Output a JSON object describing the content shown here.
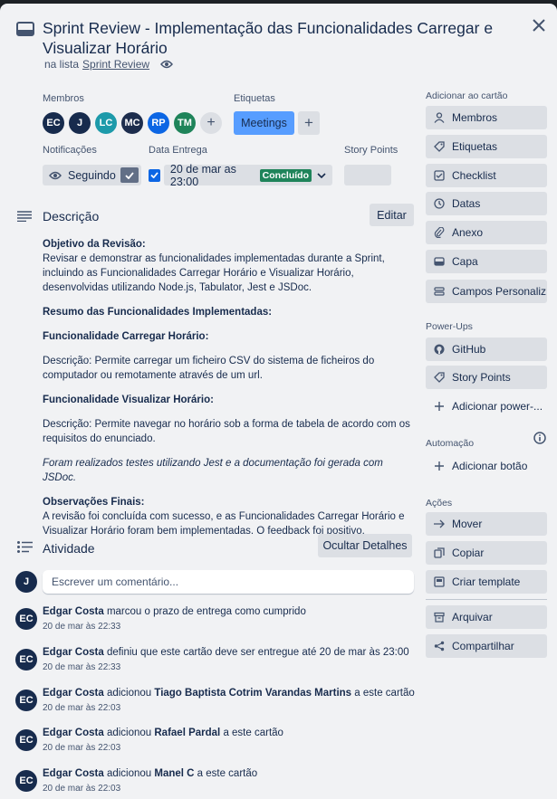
{
  "card": {
    "title": "Sprint Review - Implementação das Funcionalidades Carregar e Visualizar Horário",
    "in_list_prefix": "na lista",
    "list_name": "Sprint Review"
  },
  "members": {
    "label": "Membros",
    "avatars": [
      {
        "initials": "EC",
        "color": "#172b4d"
      },
      {
        "initials": "J",
        "color": "#172b4d"
      },
      {
        "initials": "LC",
        "color": "#1d9aaa"
      },
      {
        "initials": "MC",
        "color": "#1d2d4d"
      },
      {
        "initials": "RP",
        "color": "#0c66e4"
      },
      {
        "initials": "TM",
        "color": "#1f845a"
      }
    ],
    "add": "+"
  },
  "labels": {
    "label": "Etiquetas",
    "chip": "Meetings",
    "add": "+"
  },
  "notifications": {
    "label": "Notificações",
    "value": "Seguindo"
  },
  "due": {
    "label": "Data Entrega",
    "value": "20 de mar as 23:00",
    "badge": "Concluído"
  },
  "story_points": {
    "label": "Story Points"
  },
  "description": {
    "title": "Descrição",
    "edit": "Editar",
    "objective_title": "Objetivo da Revisão:",
    "objective_text": "Revisar e demonstrar as funcionalidades implementadas durante a Sprint, incluindo as Funcionalidades Carregar Horário e Visualizar Horário, desenvolvidas utilizando Node.js, Tabulator, Jest e JSDoc.",
    "summary_title": "Resumo das Funcionalidades Implementadas:",
    "f1_title": "Funcionalidade Carregar Horário:",
    "f1_text": "Descrição: Permite carregar um ficheiro CSV do sistema de ficheiros do computador ou remotamente através de um url.",
    "f2_title": "Funcionalidade Visualizar Horário:",
    "f2_text": "Descrição: Permite navegar no horário sob a forma de tabela de acordo com os requisitos do enunciado.",
    "tests_text": "Foram realizados testes utilizando Jest e a documentação foi gerada com JSDoc.",
    "final_title": "Observações Finais:",
    "final_text": "A revisão foi concluída com sucesso, e as Funcionalidades Carregar Horário e Visualizar Horário foram bem implementadas. O feedback foi positivo."
  },
  "activity": {
    "title": "Atividade",
    "hide_details": "Ocultar Detalhes",
    "comment_avatar": "J",
    "comment_placeholder": "Escrever um comentário...",
    "items": [
      {
        "initials": "EC",
        "who": "Edgar Costa",
        "text": " marcou o prazo de entrega como cumprido",
        "bold": "",
        "tail": "",
        "time": "20 de mar às 22:33"
      },
      {
        "initials": "EC",
        "who": "Edgar Costa",
        "text": " definiu que este cartão deve ser entregue até 20 de mar às 23:00",
        "bold": "",
        "tail": "",
        "time": "20 de mar às 22:33"
      },
      {
        "initials": "EC",
        "who": "Edgar Costa",
        "text": " adicionou ",
        "bold": "Tiago Baptista Cotrim Varandas Martins",
        "tail": " a este cartão",
        "time": "20 de mar às 22:03"
      },
      {
        "initials": "EC",
        "who": "Edgar Costa",
        "text": " adicionou ",
        "bold": "Rafael Pardal",
        "tail": " a este cartão",
        "time": "20 de mar às 22:03"
      },
      {
        "initials": "EC",
        "who": "Edgar Costa",
        "text": " adicionou ",
        "bold": "Manel C",
        "tail": " a este cartão",
        "time": "20 de mar às 22:03"
      }
    ]
  },
  "sidebar": {
    "add_label": "Adicionar ao cartão",
    "add_items": [
      {
        "label": "Membros",
        "icon": "user-icon"
      },
      {
        "label": "Etiquetas",
        "icon": "tag-icon"
      },
      {
        "label": "Checklist",
        "icon": "checklist-icon"
      },
      {
        "label": "Datas",
        "icon": "clock-icon"
      },
      {
        "label": "Anexo",
        "icon": "paperclip-icon"
      },
      {
        "label": "Capa",
        "icon": "cover-icon"
      },
      {
        "label": "Campos Personaliz...",
        "icon": "custom-fields-icon"
      }
    ],
    "powerups_label": "Power-Ups",
    "powerups": [
      {
        "label": "GitHub",
        "icon": "github-icon"
      },
      {
        "label": "Story Points",
        "icon": "story-points-icon"
      },
      {
        "label": "Adicionar power-...",
        "icon": "plus-icon"
      }
    ],
    "automation_label": "Automação",
    "automation_add": "Adicionar botão",
    "actions_label": "Ações",
    "actions": [
      {
        "label": "Mover",
        "icon": "arrow-right-icon"
      },
      {
        "label": "Copiar",
        "icon": "copy-icon"
      },
      {
        "label": "Criar template",
        "icon": "template-icon"
      },
      {
        "label": "Arquivar",
        "icon": "archive-icon"
      },
      {
        "label": "Compartilhar",
        "icon": "share-icon"
      }
    ]
  },
  "colors": {
    "accent": "#579dff",
    "success": "#1f845a",
    "primary": "#0c66e4"
  }
}
